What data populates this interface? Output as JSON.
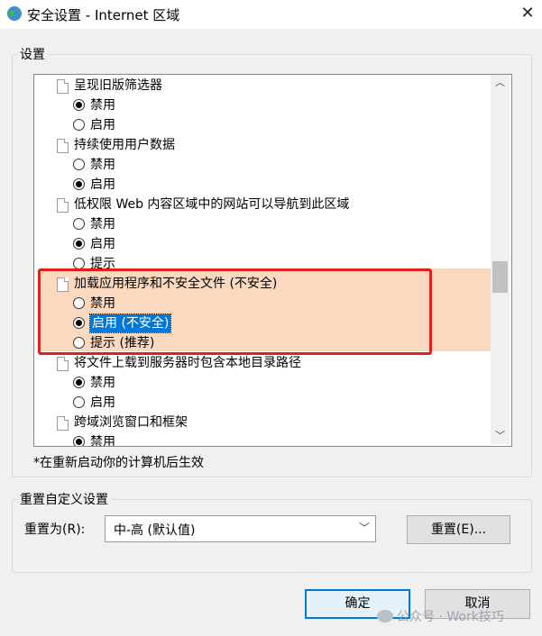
{
  "window": {
    "title": "安全设置 - Internet 区域",
    "close_glyph": "✕"
  },
  "settings_group": {
    "legend": "设置",
    "items": [
      {
        "kind": "setting",
        "text": "呈现旧版筛选器"
      },
      {
        "kind": "option",
        "text": "禁用",
        "checked": true
      },
      {
        "kind": "option",
        "text": "启用",
        "checked": false
      },
      {
        "kind": "setting",
        "text": "持续使用用户数据"
      },
      {
        "kind": "option",
        "text": "禁用",
        "checked": false
      },
      {
        "kind": "option",
        "text": "启用",
        "checked": true
      },
      {
        "kind": "setting",
        "text": "低权限 Web 内容区域中的网站可以导航到此区域"
      },
      {
        "kind": "option",
        "text": "禁用",
        "checked": false
      },
      {
        "kind": "option",
        "text": "启用",
        "checked": true
      },
      {
        "kind": "option",
        "text": "提示",
        "checked": false
      },
      {
        "kind": "setting",
        "text": "加载应用程序和不安全文件 (不安全)"
      },
      {
        "kind": "option",
        "text": "禁用",
        "checked": false
      },
      {
        "kind": "option",
        "text": "启用 (不安全)",
        "checked": true,
        "selected": true
      },
      {
        "kind": "option",
        "text": "提示 (推荐)",
        "checked": false
      },
      {
        "kind": "setting",
        "text": "将文件上载到服务器时包含本地目录路径"
      },
      {
        "kind": "option",
        "text": "禁用",
        "checked": true
      },
      {
        "kind": "option",
        "text": "启用",
        "checked": false
      },
      {
        "kind": "setting",
        "text": "跨域浏览窗口和框架"
      },
      {
        "kind": "option",
        "text": "禁用",
        "checked": true
      }
    ],
    "note": "*在重新启动你的计算机后生效",
    "highlight_color": "#e0201c"
  },
  "reset_group": {
    "legend": "重置自定义设置",
    "label": "重置为(R):",
    "select_value": "中-高 (默认值)",
    "reset_button": "重置(E)..."
  },
  "footer": {
    "ok_button": "确定",
    "cancel_button": "取消",
    "watermark": "公众号 · Work技巧"
  }
}
